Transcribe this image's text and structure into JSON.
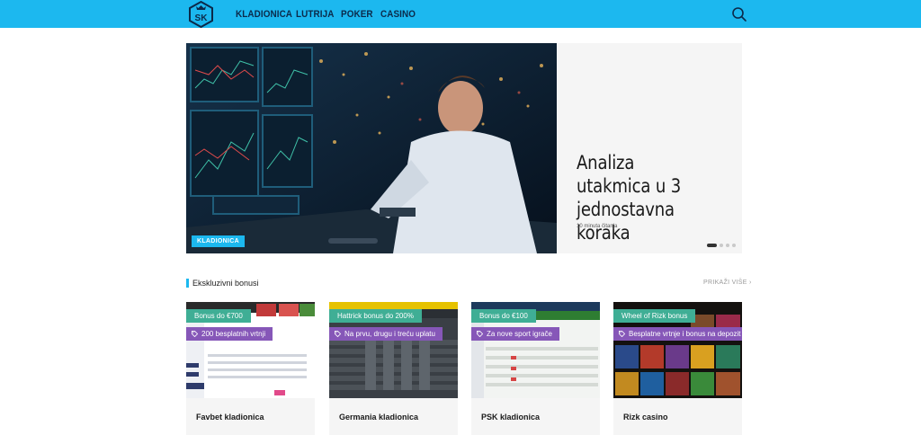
{
  "header": {
    "logo_text": "SK",
    "nav": [
      "KLADIONICA",
      "LUTRIJA",
      "POKER",
      "CASINO"
    ],
    "search_icon": "search-icon",
    "colors": {
      "bar": "#1cb8ef",
      "nav_text": "#0b2a4a"
    }
  },
  "hero": {
    "tag": "KLADIONICA",
    "title": "Analiza utakmica u 3 jednostavna koraka",
    "meta": "10 minuta čitanja",
    "slides": 4,
    "active_slide": 1
  },
  "bonuses": {
    "section_title": "Ekskluzivni bonusi",
    "more_link": "PRIKAŽI VIŠE",
    "cards": [
      {
        "bonus": "Bonus do €700",
        "offer": "200 besplatnih vrtnji",
        "name": "Favbet kladionica"
      },
      {
        "bonus": "Hattrick bonus do 200%",
        "offer": "Na prvu, drugu i treću uplatu",
        "name": "Germania kladionica"
      },
      {
        "bonus": "Bonus do €100",
        "offer": "Za nove sport igrače",
        "name": "PSK kladionica"
      },
      {
        "bonus": "Wheel of Rizk bonus",
        "offer": "Besplatne vrtnje i bonus na depozit",
        "name": "Rizk casino"
      }
    ],
    "colors": {
      "bonus_badge": "#3fae95",
      "offer_badge": "#8657b8"
    }
  }
}
